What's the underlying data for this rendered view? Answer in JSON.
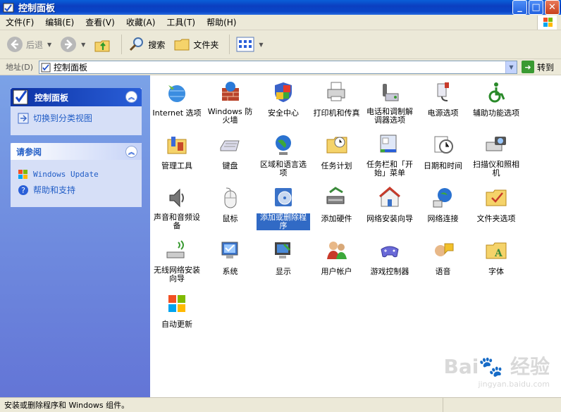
{
  "window": {
    "title": "控制面板"
  },
  "menu": [
    "文件(F)",
    "编辑(E)",
    "查看(V)",
    "收藏(A)",
    "工具(T)",
    "帮助(H)"
  ],
  "toolbar": {
    "back": "后退",
    "search": "搜索",
    "folders": "文件夹"
  },
  "address": {
    "label": "地址(D)",
    "value": "控制面板",
    "go": "转到"
  },
  "leftpane": {
    "main_title": "控制面板",
    "switch_view": "切换到分类视图",
    "see_also_title": "请参阅",
    "see_also": [
      "Windows Update",
      "帮助和支持"
    ]
  },
  "icons": [
    {
      "label": "Internet 选项",
      "icon": "internet-options-icon"
    },
    {
      "label": "Windows 防火墙",
      "icon": "firewall-icon"
    },
    {
      "label": "安全中心",
      "icon": "security-center-icon"
    },
    {
      "label": "打印机和传真",
      "icon": "printer-icon"
    },
    {
      "label": "电话和调制解调器选项",
      "icon": "phone-modem-icon"
    },
    {
      "label": "电源选项",
      "icon": "power-options-icon"
    },
    {
      "label": "辅助功能选项",
      "icon": "accessibility-icon"
    },
    {
      "label": "管理工具",
      "icon": "admin-tools-icon"
    },
    {
      "label": "键盘",
      "icon": "keyboard-icon"
    },
    {
      "label": "区域和语言选项",
      "icon": "globe-icon"
    },
    {
      "label": "任务计划",
      "icon": "scheduled-tasks-icon"
    },
    {
      "label": "任务栏和「开始」菜单",
      "icon": "taskbar-icon"
    },
    {
      "label": "日期和时间",
      "icon": "clock-icon"
    },
    {
      "label": "扫描仪和照相机",
      "icon": "scanner-camera-icon"
    },
    {
      "label": "声音和音频设备",
      "icon": "speaker-icon"
    },
    {
      "label": "鼠标",
      "icon": "mouse-icon"
    },
    {
      "label": "添加或删除程序",
      "icon": "add-remove-programs-icon"
    },
    {
      "label": "添加硬件",
      "icon": "add-hardware-icon"
    },
    {
      "label": "网络安装向导",
      "icon": "network-setup-icon"
    },
    {
      "label": "网络连接",
      "icon": "network-connections-icon"
    },
    {
      "label": "文件夹选项",
      "icon": "folder-options-icon"
    },
    {
      "label": "无线网络安装向导",
      "icon": "wireless-setup-icon"
    },
    {
      "label": "系统",
      "icon": "system-icon"
    },
    {
      "label": "显示",
      "icon": "display-icon"
    },
    {
      "label": "用户帐户",
      "icon": "user-accounts-icon"
    },
    {
      "label": "游戏控制器",
      "icon": "game-controller-icon"
    },
    {
      "label": "语音",
      "icon": "speech-icon"
    },
    {
      "label": "字体",
      "icon": "fonts-icon"
    },
    {
      "label": "自动更新",
      "icon": "windows-logo-icon"
    }
  ],
  "selected_index": 16,
  "status": "安装或删除程序和 Windows 组件。",
  "watermark": {
    "big": "Bai🐾 经验",
    "small": "jingyan.baidu.com"
  }
}
